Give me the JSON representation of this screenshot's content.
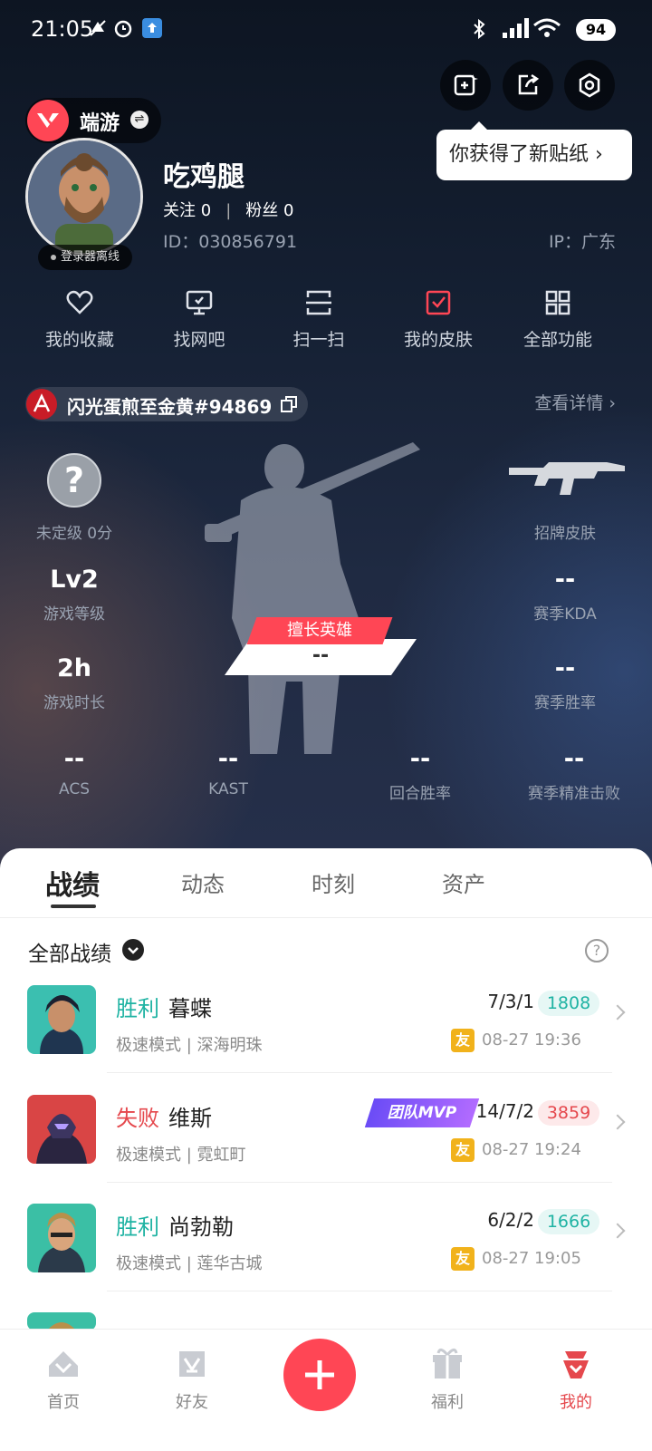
{
  "status_bar": {
    "time": "21:05",
    "battery": "94"
  },
  "game_switcher": {
    "name": "端游"
  },
  "toolbar": {
    "sticker_tooltip": "你获得了新贴纸 ›"
  },
  "profile": {
    "avatar_status": "登录器离线",
    "username": "吃鸡腿",
    "follow_label": "关注 0",
    "fans_label": "粉丝 0",
    "follow_separator": "|",
    "id_text": "ID：030856791",
    "ip_text": "IP：广东"
  },
  "shortcuts": [
    {
      "label": "我的收藏",
      "icon": "heart-icon"
    },
    {
      "label": "找网吧",
      "icon": "monitor-icon"
    },
    {
      "label": "扫一扫",
      "icon": "scan-icon"
    },
    {
      "label": "我的皮肤",
      "icon": "skin-icon"
    },
    {
      "label": "全部功能",
      "icon": "grid-icon"
    }
  ],
  "riot_id": {
    "text": "闪光蛋煎至金黄#94869",
    "details_link": "查看详情 ›"
  },
  "stats": {
    "rank_icon_text": "?",
    "rank_label": "未定级 0分",
    "skin_label": "招牌皮肤",
    "level_value": "Lv2",
    "level_label": "游戏等级",
    "kda_value": "--",
    "kda_label": "赛季KDA",
    "hours_value": "2h",
    "hours_label": "游戏时长",
    "winrate_value": "--",
    "winrate_label": "赛季胜率",
    "best_agent_badge": "擅长英雄",
    "best_agent_value": "--",
    "acs_value": "--",
    "acs_label": "ACS",
    "kast_value": "--",
    "kast_label": "KAST",
    "round_value": "--",
    "round_label": "回合胜率",
    "headshot_value": "--",
    "headshot_label": "赛季精准击败"
  },
  "tabs": [
    "战绩",
    "动态",
    "时刻",
    "资产"
  ],
  "filter": {
    "label": "全部战绩",
    "help_icon": "?"
  },
  "matches": [
    {
      "result": "胜利",
      "agent": "暮蝶",
      "mode": "极速模式 | 深海明珠",
      "kda": "7/3/1",
      "score": "1808",
      "friend": "友",
      "time": "08-27 19:36"
    },
    {
      "result": "失败",
      "agent": "维斯",
      "mode": "极速模式 | 霓虹町",
      "kda": "14/7/2",
      "score": "3859",
      "friend": "友",
      "time": "08-27 19:24",
      "badge": "团队MVP"
    },
    {
      "result": "胜利",
      "agent": "尚勃勒",
      "mode": "极速模式 | 莲华古城",
      "kda": "6/2/2",
      "score": "1666",
      "friend": "友",
      "time": "08-27 19:05"
    }
  ],
  "nav": [
    "首页",
    "好友",
    "福利",
    "我的"
  ],
  "colors": {
    "accent": "#ff4655",
    "win": "#1fb3a3",
    "loss": "#e5484d"
  }
}
